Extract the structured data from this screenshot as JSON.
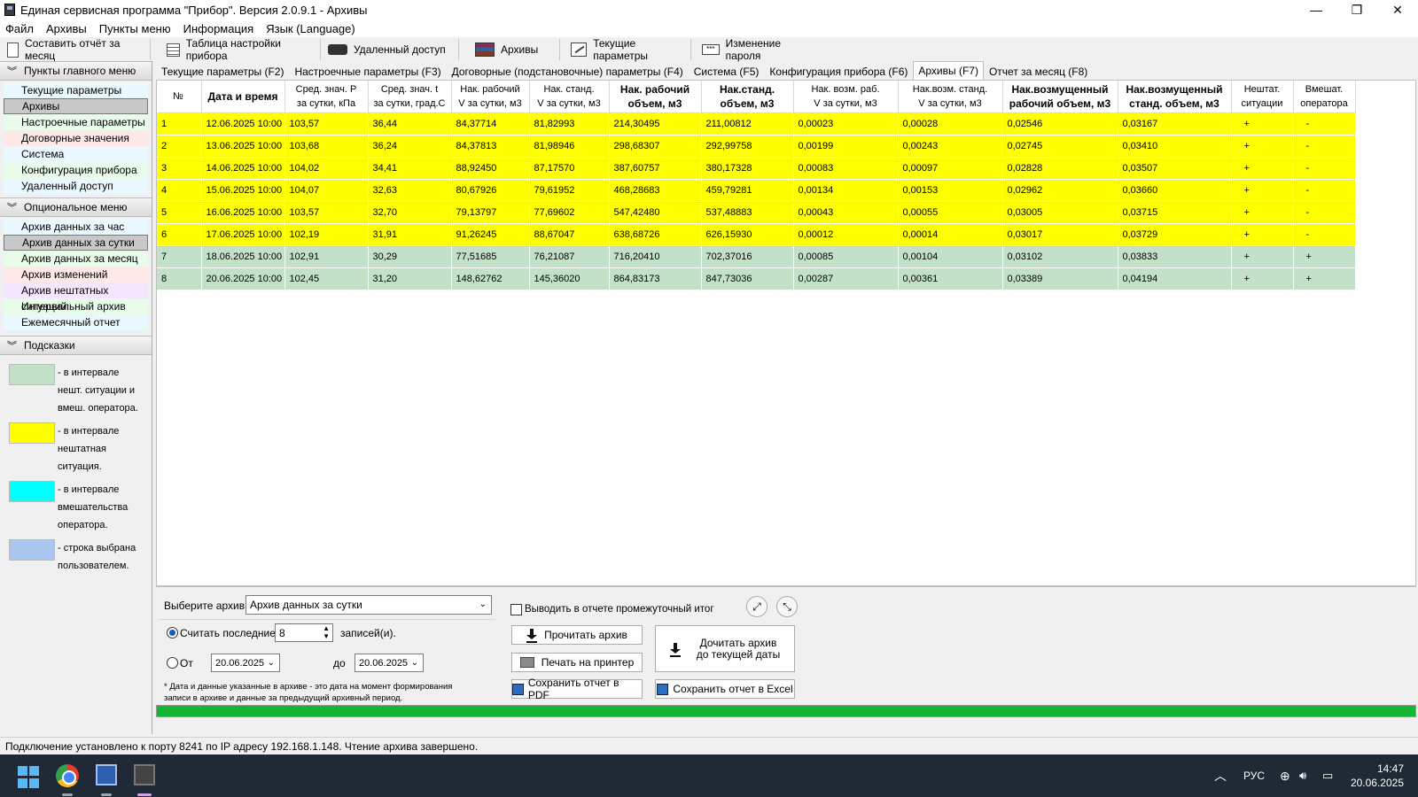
{
  "window": {
    "title": "Единая сервисная программа \"Прибор\".  Версия 2.0.9.1 - Архивы",
    "buttons": {
      "minimize": "—",
      "maximize": "❐",
      "close": "✕"
    }
  },
  "menu": [
    "Файл",
    "Архивы",
    "Пункты меню",
    "Информация",
    "Язык (Language)"
  ],
  "toolbar": [
    {
      "label": "Составить отчёт за месяц",
      "icon": "report-icon"
    },
    {
      "label": "Таблица настройки прибора",
      "icon": "table-icon"
    },
    {
      "label": "Удаленный доступ",
      "icon": "remote-icon"
    },
    {
      "label": "Архивы",
      "icon": "archive-icon"
    },
    {
      "label": "Текущие параметры",
      "icon": "params-icon"
    },
    {
      "label": "Изменение пароля",
      "icon": "password-icon"
    }
  ],
  "sidebar": {
    "main_header": "Пункты главного меню",
    "main_items": [
      {
        "label": "Текущие параметры",
        "color": "#eaf8ff"
      },
      {
        "label": "Архивы",
        "color": "#c8c8c8",
        "selected": true
      },
      {
        "label": "Настроечные параметры",
        "color": "#e9fbe9"
      },
      {
        "label": "Договорные значения",
        "color": "#ffe8e8"
      },
      {
        "label": "Система",
        "color": "#eaf8ff"
      },
      {
        "label": "Конфигурация прибора",
        "color": "#e9fbe9"
      },
      {
        "label": "Удаленный доступ",
        "color": "#eaf8ff"
      }
    ],
    "opt_header": "Опциональное меню",
    "opt_items": [
      {
        "label": "Архив данных за час",
        "color": "#eaf8ff"
      },
      {
        "label": "Архив данных за сутки",
        "color": "#c8c8c8",
        "selected": true
      },
      {
        "label": "Архив данных за месяц",
        "color": "#e9fbe9"
      },
      {
        "label": "Архив изменений",
        "color": "#ffe8e8"
      },
      {
        "label": "Архив нештатных ситуаций",
        "color": "#f4e6ff"
      },
      {
        "label": "Интервальный архив",
        "color": "#e9fbe9"
      },
      {
        "label": "Ежемесячный отчет",
        "color": "#eaf8ff"
      }
    ],
    "hints_header": "Подсказки",
    "hints": [
      {
        "color": "#c3e0c8",
        "text": "- в интервале нешт. ситуации и вмеш. оператора."
      },
      {
        "color": "#ffff00",
        "text": "- в интервале нештатная ситуация."
      },
      {
        "color": "#00ffff",
        "text": "- в интервале вмешательства оператора."
      },
      {
        "color": "#a9c6ef",
        "text": "- строка выбрана пользователем."
      }
    ]
  },
  "tabs": [
    "Текущие параметры (F2)",
    "Настроечные параметры (F3)",
    "Договорные (подстановочные) параметры (F4)",
    "Система (F5)",
    "Конфигурация прибора (F6)",
    "Архивы (F7)",
    "Отчет за месяц (F8)"
  ],
  "active_tab": 5,
  "grid": {
    "columns": [
      {
        "l1": "№",
        "l2": "",
        "bold": false
      },
      {
        "l1": "Дата и время",
        "l2": "",
        "bold": true
      },
      {
        "l1": "Сред. знач. P",
        "l2": "за сутки, кПа",
        "bold": false
      },
      {
        "l1": "Сред. знач.  t",
        "l2": "за сутки, град.С",
        "bold": false
      },
      {
        "l1": "Нак. рабочий",
        "l2": "V за сутки, м3",
        "bold": false
      },
      {
        "l1": "Нак. станд.",
        "l2": "V за сутки, м3",
        "bold": false
      },
      {
        "l1": "Нак. рабочий",
        "l2": "объем, м3",
        "bold": true
      },
      {
        "l1": "Нак.станд.",
        "l2": "объем, м3",
        "bold": true
      },
      {
        "l1": "Нак. возм. раб.",
        "l2": "V за сутки, м3",
        "bold": false
      },
      {
        "l1": "Нак.возм. станд.",
        "l2": "V за сутки, м3",
        "bold": false
      },
      {
        "l1": "Нак.возмущенный",
        "l2": "рабочий объем, м3",
        "bold": true
      },
      {
        "l1": "Нак.возмущенный",
        "l2": "станд. объем, м3",
        "bold": true
      },
      {
        "l1": "Нештат.",
        "l2": "ситуации",
        "bold": false
      },
      {
        "l1": "Вмешат.",
        "l2": "оператора",
        "bold": false
      }
    ],
    "rows": [
      {
        "color": "#ffff00",
        "cells": [
          "1",
          "12.06.2025 10:00",
          "103,57",
          "36,44",
          "84,37714",
          "81,82993",
          "214,30495",
          "211,00812",
          "0,00023",
          "0,00028",
          "0,02546",
          "0,03167",
          "+",
          "-"
        ]
      },
      {
        "color": "#ffff00",
        "cells": [
          "2",
          "13.06.2025 10:00",
          "103,68",
          "36,24",
          "84,37813",
          "81,98946",
          "298,68307",
          "292,99758",
          "0,00199",
          "0,00243",
          "0,02745",
          "0,03410",
          "+",
          "-"
        ]
      },
      {
        "color": "#ffff00",
        "cells": [
          "3",
          "14.06.2025 10:00",
          "104,02",
          "34,41",
          "88,92450",
          "87,17570",
          "387,60757",
          "380,17328",
          "0,00083",
          "0,00097",
          "0,02828",
          "0,03507",
          "+",
          "-"
        ]
      },
      {
        "color": "#ffff00",
        "cells": [
          "4",
          "15.06.2025 10:00",
          "104,07",
          "32,63",
          "80,67926",
          "79,61952",
          "468,28683",
          "459,79281",
          "0,00134",
          "0,00153",
          "0,02962",
          "0,03660",
          "+",
          "-"
        ]
      },
      {
        "color": "#ffff00",
        "cells": [
          "5",
          "16.06.2025 10:00",
          "103,57",
          "32,70",
          "79,13797",
          "77,69602",
          "547,42480",
          "537,48883",
          "0,00043",
          "0,00055",
          "0,03005",
          "0,03715",
          "+",
          "-"
        ]
      },
      {
        "color": "#ffff00",
        "cells": [
          "6",
          "17.06.2025 10:00",
          "102,19",
          "31,91",
          "91,26245",
          "88,67047",
          "638,68726",
          "626,15930",
          "0,00012",
          "0,00014",
          "0,03017",
          "0,03729",
          "+",
          "-"
        ]
      },
      {
        "color": "#c3e0c8",
        "cells": [
          "7",
          "18.06.2025 10:00",
          "102,91",
          "30,29",
          "77,51685",
          "76,21087",
          "716,20410",
          "702,37016",
          "0,00085",
          "0,00104",
          "0,03102",
          "0,03833",
          "+",
          "+"
        ]
      },
      {
        "color": "#c3e0c8",
        "cells": [
          "8",
          "20.06.2025 10:00",
          "102,45",
          "31,20",
          "148,62762",
          "145,36020",
          "864,83173",
          "847,73036",
          "0,00287",
          "0,00361",
          "0,03389",
          "0,04194",
          "+",
          "+"
        ]
      }
    ]
  },
  "bottom": {
    "select_label": "Выберите архив:",
    "select_value": "Архив данных за сутки",
    "subtotal_label": "Выводить в отчете промежуточный итог",
    "subtotal_checked": false,
    "read_last_label": "Считать последние",
    "read_last_value": "8",
    "records_label": "записей(и).",
    "from_label": "От",
    "from_value": "20.06.2025",
    "to_label": "до",
    "to_value": "20.06.2025",
    "note": "* Дата и данные указанные в архиве - это дата на момент формирования записи в архиве и данные за предыдущий архивный период.",
    "read_button": "Прочитать архив",
    "print_button": "Печать на принтер",
    "pdf_button": "Сохранить отчет в PDF",
    "excel_button": "Сохранить отчет в  Excel",
    "readto_button_l1": "Дочитать архив",
    "readto_button_l2": "до текущей даты",
    "progress": 1.0,
    "progress_color": "#16b534"
  },
  "status": "Подключение установлено к порту 8241 по IP адресу 192.168.1.148. Чтение архива завершено.",
  "taskbar": {
    "lang": "РУС",
    "time": "14:47",
    "date": "20.06.2025"
  }
}
